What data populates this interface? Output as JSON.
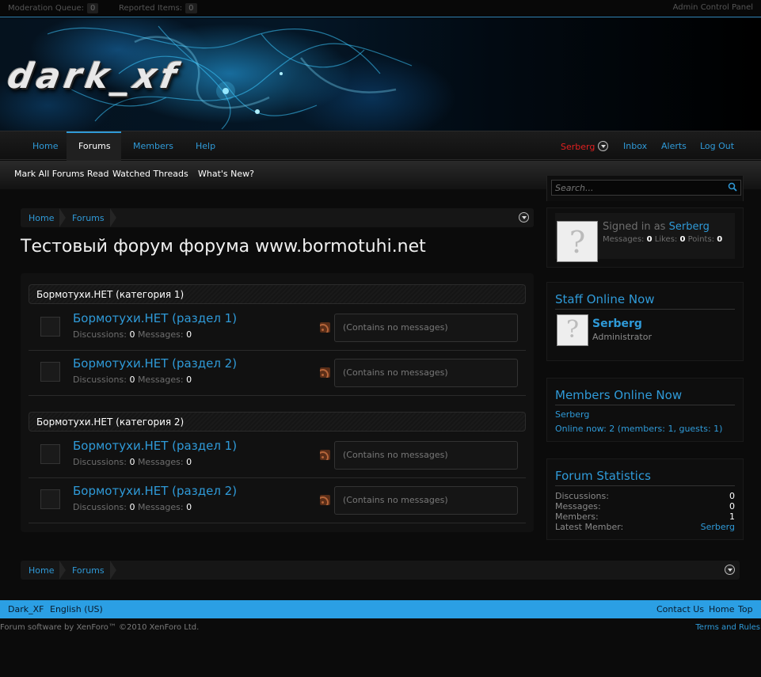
{
  "admin_bar": {
    "moderation_label": "Moderation Queue:",
    "moderation_count": "0",
    "reported_label": "Reported Items:",
    "reported_count": "0",
    "acp_label": "Admin Control Panel"
  },
  "header": {
    "logo_text": "dark_xf"
  },
  "nav": {
    "tabs": [
      {
        "label": "Home"
      },
      {
        "label": "Forums",
        "active": true
      },
      {
        "label": "Members"
      },
      {
        "label": "Help"
      }
    ],
    "username": "Serberg",
    "inbox": "Inbox",
    "alerts": "Alerts",
    "logout": "Log Out"
  },
  "subnav": {
    "items": [
      {
        "label": "Mark All Forums Read"
      },
      {
        "label": "Watched Threads"
      },
      {
        "label": "What's New?"
      }
    ]
  },
  "search": {
    "placeholder": "Search..."
  },
  "breadcrumb": {
    "items": [
      {
        "label": "Home"
      },
      {
        "label": "Forums"
      }
    ]
  },
  "page_title": "Тестовый форум форума www.bormotuhi.net",
  "categories": [
    {
      "title": "Бормотухи.НЕТ (категория 1)",
      "forums": [
        {
          "title": "Бормотухи.НЕТ (раздел 1)",
          "discussions_label": "Discussions:",
          "discussions": "0",
          "messages_label": "Messages:",
          "messages": "0",
          "last_post": "(Contains no messages)"
        },
        {
          "title": "Бормотухи.НЕТ (раздел 2)",
          "discussions_label": "Discussions:",
          "discussions": "0",
          "messages_label": "Messages:",
          "messages": "0",
          "last_post": "(Contains no messages)"
        }
      ]
    },
    {
      "title": "Бормотухи.НЕТ (категория 2)",
      "forums": [
        {
          "title": "Бормотухи.НЕТ (раздел 1)",
          "discussions_label": "Discussions:",
          "discussions": "0",
          "messages_label": "Messages:",
          "messages": "0",
          "last_post": "(Contains no messages)"
        },
        {
          "title": "Бормотухи.НЕТ (раздел 2)",
          "discussions_label": "Discussions:",
          "discussions": "0",
          "messages_label": "Messages:",
          "messages": "0",
          "last_post": "(Contains no messages)"
        }
      ]
    }
  ],
  "sidebar": {
    "visitor": {
      "signed_in_label": "Signed in as",
      "username": "Serberg",
      "messages_label": "Messages:",
      "messages": "0",
      "likes_label": "Likes:",
      "likes": "0",
      "points_label": "Points:",
      "points": "0"
    },
    "staff": {
      "heading": "Staff Online Now",
      "username": "Serberg",
      "role": "Administrator"
    },
    "members_online": {
      "heading": "Members Online Now",
      "user": "Serberg",
      "summary": "Online now: 2 (members: 1, guests: 1)"
    },
    "stats": {
      "heading": "Forum Statistics",
      "rows": [
        {
          "label": "Discussions:",
          "value": "0"
        },
        {
          "label": "Messages:",
          "value": "0"
        },
        {
          "label": "Members:",
          "value": "1"
        },
        {
          "label": "Latest Member:",
          "value": "Serberg"
        }
      ]
    }
  },
  "footer": {
    "style": "Dark_XF",
    "language": "English (US)",
    "contact": "Contact Us",
    "home": "Home",
    "top": "Top",
    "copyright": "Forum software by XenForo™ ©2010 XenForo Ltd.",
    "terms": "Terms and Rules"
  },
  "colors": {
    "accent": "#2f9ad8",
    "footer_bar": "#2b9fe4",
    "username_red": "#e02020",
    "background": "#0b0b0b"
  }
}
